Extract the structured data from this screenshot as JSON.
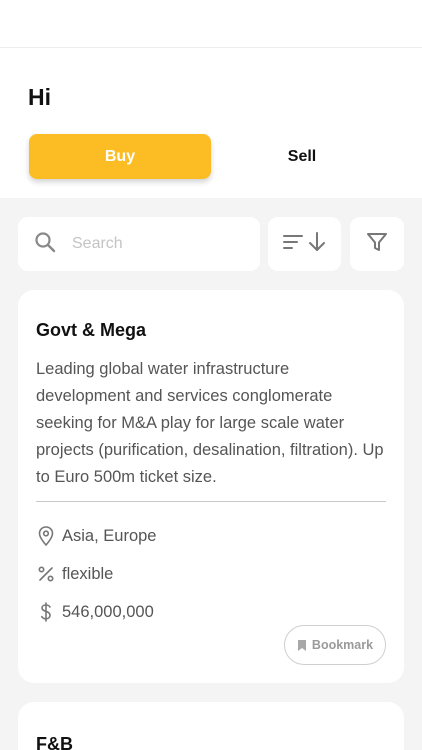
{
  "header": {
    "greeting": "Hi"
  },
  "tabs": [
    {
      "label": "Buy",
      "active": true
    },
    {
      "label": "Sell",
      "active": false
    }
  ],
  "search": {
    "placeholder": "Search"
  },
  "toolbar": {
    "sort_icon": "sort-descending-icon",
    "filter_icon": "filter-icon"
  },
  "listings": [
    {
      "title": "Govt & Mega",
      "description": " Leading global water infrastructure development and services conglomerate seeking for M&A play for large scale water projects (purification, desalination, filtration). Up to Euro 500m ticket size.",
      "location": "Asia, Europe",
      "stake": "flexible",
      "price": "546,000,000",
      "bookmark_label": "Bookmark"
    },
    {
      "title": "F&B"
    }
  ],
  "colors": {
    "accent": "#fbbd23",
    "background": "#f4f4f4"
  }
}
